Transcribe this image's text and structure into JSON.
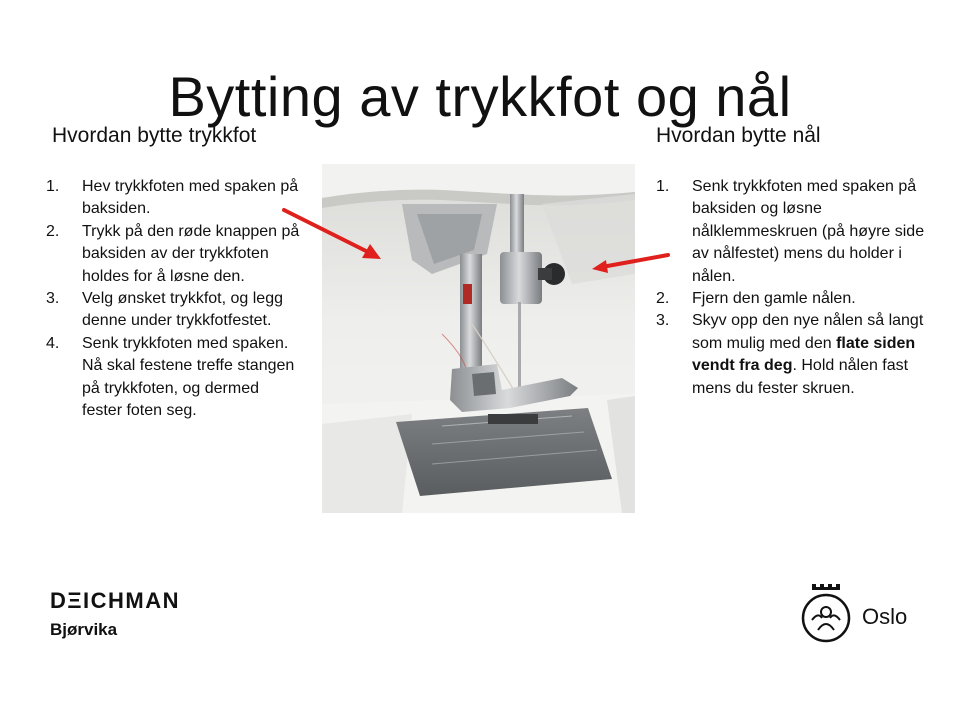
{
  "title": "Bytting av trykkfot og nål",
  "left": {
    "heading": "Hvordan bytte trykkfot",
    "steps": [
      {
        "num": "1.",
        "text": "Hev trykkfoten med spaken på baksiden."
      },
      {
        "num": "2.",
        "text": "Trykk på den røde knappen på baksiden av der trykkfoten holdes for å løsne den."
      },
      {
        "num": "3.",
        "text": "Velg ønsket trykkfot, og legg denne under trykkfotfestet."
      },
      {
        "num": "4.",
        "text": "Senk trykkfoten med spaken. Nå skal festene treffe stangen på trykkfoten, og dermed fester foten seg."
      }
    ]
  },
  "right": {
    "heading": "Hvordan bytte nål",
    "steps": [
      {
        "num": "1.",
        "text": "Senk trykkfoten med spaken på baksiden og løsne nålklemmeskruen (på høyre side av nålfestet) mens du holder i nålen."
      },
      {
        "num": "2.",
        "text": "Fjern den gamle nålen."
      },
      {
        "num": "3.",
        "text_before": "Skyv opp den nye nålen så langt som mulig med den ",
        "text_bold": "flate siden vendt fra deg",
        "text_after": ". Hold nålen fast mens du fester skruen."
      }
    ]
  },
  "brand_left": {
    "name": "DΞICHMAN",
    "sub": "Bjørvika"
  },
  "brand_right": {
    "name": "Oslo"
  },
  "colors": {
    "arrow": "#e0201c",
    "text": "#111111",
    "background": "#ffffff"
  }
}
